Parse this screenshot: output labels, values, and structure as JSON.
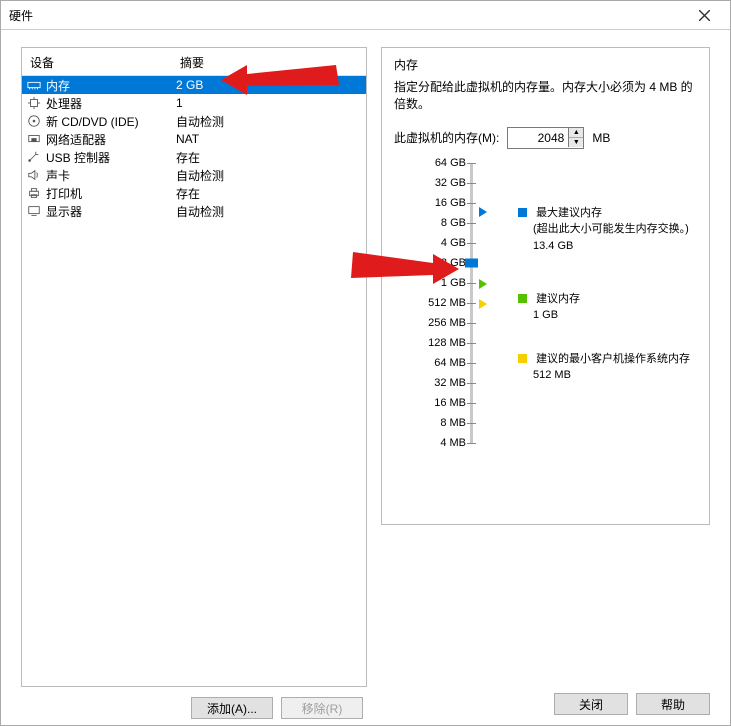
{
  "title": "硬件",
  "columns": {
    "device": "设备",
    "summary": "摘要"
  },
  "rows": [
    {
      "icon": "memory",
      "name": "内存",
      "summary": "2 GB",
      "selected": true
    },
    {
      "icon": "cpu",
      "name": "处理器",
      "summary": "1"
    },
    {
      "icon": "cd",
      "name": "新 CD/DVD (IDE)",
      "summary": "自动检测"
    },
    {
      "icon": "net",
      "name": "网络适配器",
      "summary": "NAT"
    },
    {
      "icon": "usb",
      "name": "USB 控制器",
      "summary": "存在"
    },
    {
      "icon": "sound",
      "name": "声卡",
      "summary": "自动检测"
    },
    {
      "icon": "printer",
      "name": "打印机",
      "summary": "存在"
    },
    {
      "icon": "display",
      "name": "显示器",
      "summary": "自动检测"
    }
  ],
  "buttons": {
    "add": "添加(A)...",
    "remove": "移除(R)",
    "close": "关闭",
    "help": "帮助"
  },
  "mem": {
    "group": "内存",
    "desc": "指定分配给此虚拟机的内存量。内存大小必须为 4 MB 的倍数。",
    "label": "此虚拟机的内存(M):",
    "value": "2048",
    "unit": "MB",
    "ticks": [
      "64 GB",
      "32 GB",
      "16 GB",
      "8 GB",
      "4 GB",
      "2 GB",
      "1 GB",
      "512 MB",
      "256 MB",
      "128 MB",
      "64 MB",
      "32 MB",
      "16 MB",
      "8 MB",
      "4 MB"
    ],
    "legend": {
      "max": {
        "title": "最大建议内存",
        "note": "(超出此大小可能发生内存交换。)",
        "val": "13.4 GB"
      },
      "rec": {
        "title": "建议内存",
        "val": "1 GB"
      },
      "min": {
        "title": "建议的最小客户机操作系统内存",
        "val": "512 MB"
      }
    }
  }
}
